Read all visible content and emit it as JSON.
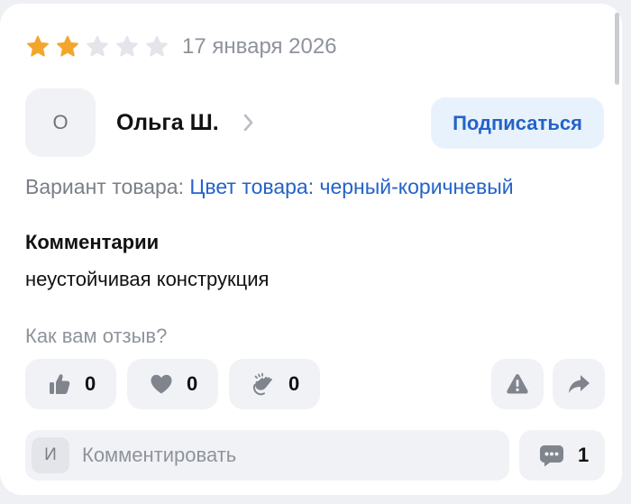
{
  "review": {
    "rating": 2,
    "max_rating": 5,
    "date": "17 января 2026",
    "author": {
      "initial": "О",
      "name": "Ольга Ш."
    },
    "subscribe_label": "Подписаться",
    "variant": {
      "label": "Вариант товара:",
      "value": "Цвет товара: черный-коричневый"
    },
    "comments_heading": "Комментарии",
    "comments_text": "неустойчивая конструкция"
  },
  "feedback": {
    "question": "Как вам отзыв?",
    "reactions": [
      {
        "icon": "thumbs-up-icon",
        "count": "0"
      },
      {
        "icon": "heart-icon",
        "count": "0"
      },
      {
        "icon": "clapping-hands-icon",
        "count": "0"
      }
    ]
  },
  "comment_box": {
    "user_initial": "И",
    "placeholder": "Комментировать",
    "comments_count": "1"
  },
  "colors": {
    "star_filled": "#f3a62b",
    "star_empty": "#e3e5ea",
    "accent": "#2463c9",
    "icon_gray": "#80858d"
  }
}
